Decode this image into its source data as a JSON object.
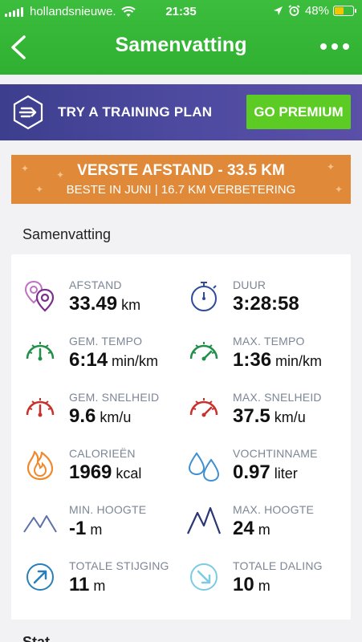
{
  "status_bar": {
    "carrier": "hollandsnieuwe.",
    "time": "21:35",
    "battery": "48%",
    "battery_level": 0.48
  },
  "nav": {
    "title": "Samenvatting"
  },
  "premium_banner": {
    "label": "TRY A TRAINING PLAN",
    "button": "GO PREMIUM"
  },
  "record_banner": {
    "title": "VERSTE AFSTAND - 33.5 KM",
    "subtitle": "BESTE IN JUNI  |  16.7 KM VERBETERING"
  },
  "section_title": "Samenvatting",
  "stats": [
    {
      "label": "AFSTAND",
      "value": "33.49",
      "unit": "km",
      "icon": "location-pins-icon"
    },
    {
      "label": "DUUR",
      "value": "3:28:58",
      "unit": "",
      "icon": "stopwatch-icon"
    },
    {
      "label": "GEM. TEMPO",
      "value": "6:14",
      "unit": "min/km",
      "icon": "speedometer-green-icon"
    },
    {
      "label": "MAX. TEMPO",
      "value": "1:36",
      "unit": "min/km",
      "icon": "speedometer-green-icon"
    },
    {
      "label": "GEM. SNELHEID",
      "value": "9.6",
      "unit": "km/u",
      "icon": "speedometer-red-icon"
    },
    {
      "label": "MAX. SNELHEID",
      "value": "37.5",
      "unit": "km/u",
      "icon": "speedometer-red-icon"
    },
    {
      "label": "CALORIEËN",
      "value": "1969",
      "unit": "kcal",
      "icon": "flame-icon"
    },
    {
      "label": "VOCHTINNAME",
      "value": "0.97",
      "unit": "liter",
      "icon": "water-drops-icon"
    },
    {
      "label": "MIN. HOOGTE",
      "value": "-1",
      "unit": "m",
      "icon": "mountain-low-icon"
    },
    {
      "label": "MAX. HOOGTE",
      "value": "24",
      "unit": "m",
      "icon": "mountain-high-icon"
    },
    {
      "label": "TOTALE STIJGING",
      "value": "11",
      "unit": "m",
      "icon": "ascent-arrow-icon"
    },
    {
      "label": "TOTALE DALING",
      "value": "10",
      "unit": "m",
      "icon": "descent-arrow-icon"
    }
  ],
  "bottom_title": "Stat"
}
